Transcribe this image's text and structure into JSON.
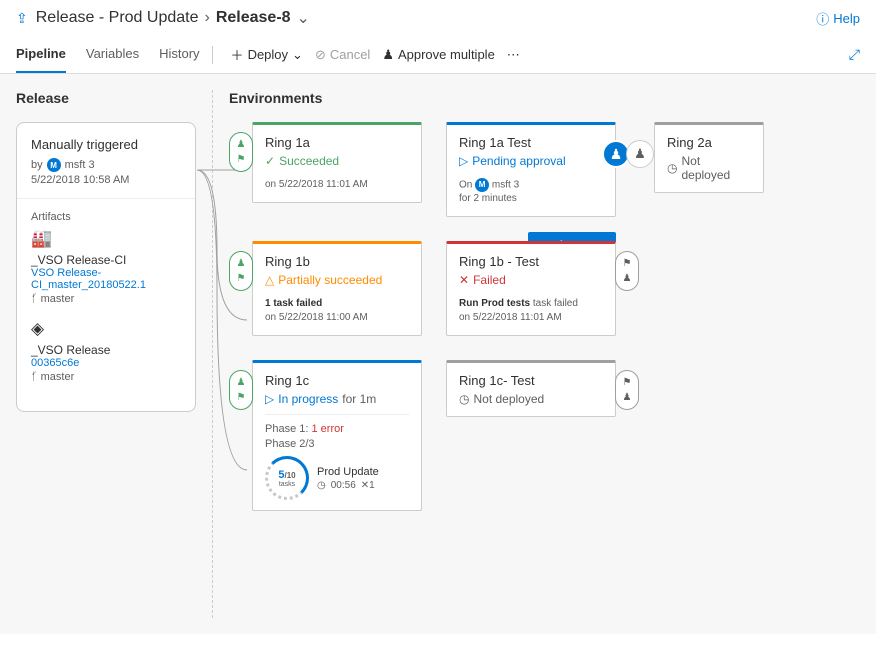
{
  "header": {
    "breadcrumb_prefix": "Release - Prod Update",
    "breadcrumb_current": "Release-8",
    "help": "Help"
  },
  "tabs": {
    "pipeline": "Pipeline",
    "variables": "Variables",
    "history": "History"
  },
  "toolbar": {
    "deploy": "Deploy",
    "cancel": "Cancel",
    "approve_multiple": "Approve multiple"
  },
  "release": {
    "section": "Release",
    "trigger": "Manually triggered",
    "by_prefix": "by",
    "by_user": "msft 3",
    "date": "5/22/2018 10:58 AM",
    "artifacts_label": "Artifacts",
    "artifacts": [
      {
        "name": "_VSO Release-CI",
        "version": "VSO Release-CI_master_20180522.1",
        "branch": "master"
      },
      {
        "name": "_VSO Release",
        "version": "00365c6e",
        "branch": "master"
      }
    ]
  },
  "env_section": "Environments",
  "stages": {
    "ring1a": {
      "name": "Ring 1a",
      "status": "Succeeded",
      "meta": "on 5/22/2018 11:01 AM"
    },
    "ring1a_test": {
      "name": "Ring 1a Test",
      "status": "Pending approval",
      "meta_prefix": "On",
      "meta_user": "msft 3",
      "meta_line2": "for 2 minutes"
    },
    "ring2a": {
      "name": "Ring 2a",
      "status": "Not deployed"
    },
    "ring1b": {
      "name": "Ring 1b",
      "status": "Partially succeeded",
      "meta_line1": "1 task failed",
      "meta_line2": "on 5/22/2018 11:00 AM"
    },
    "ring1b_test": {
      "name": "Ring 1b - Test",
      "status": "Failed",
      "meta_prefix": "Run Prod tests",
      "meta_mid": " task failed",
      "meta_line2": "on 5/22/2018 11:01 AM"
    },
    "ring1c": {
      "name": "Ring 1c",
      "status": "In progress",
      "duration": "for 1m",
      "phase1": "Phase 1:",
      "phase1_err": "1 error",
      "phase2": "Phase 2/3",
      "tasks_done": "5",
      "tasks_total": "/10",
      "tasks_lbl": "tasks",
      "task_name": "Prod Update",
      "task_time": "00:56",
      "task_fail": "1"
    },
    "ring1c_test": {
      "name": "Ring 1c- Test",
      "status": "Not deployed"
    }
  },
  "approve_btn": "Approve"
}
